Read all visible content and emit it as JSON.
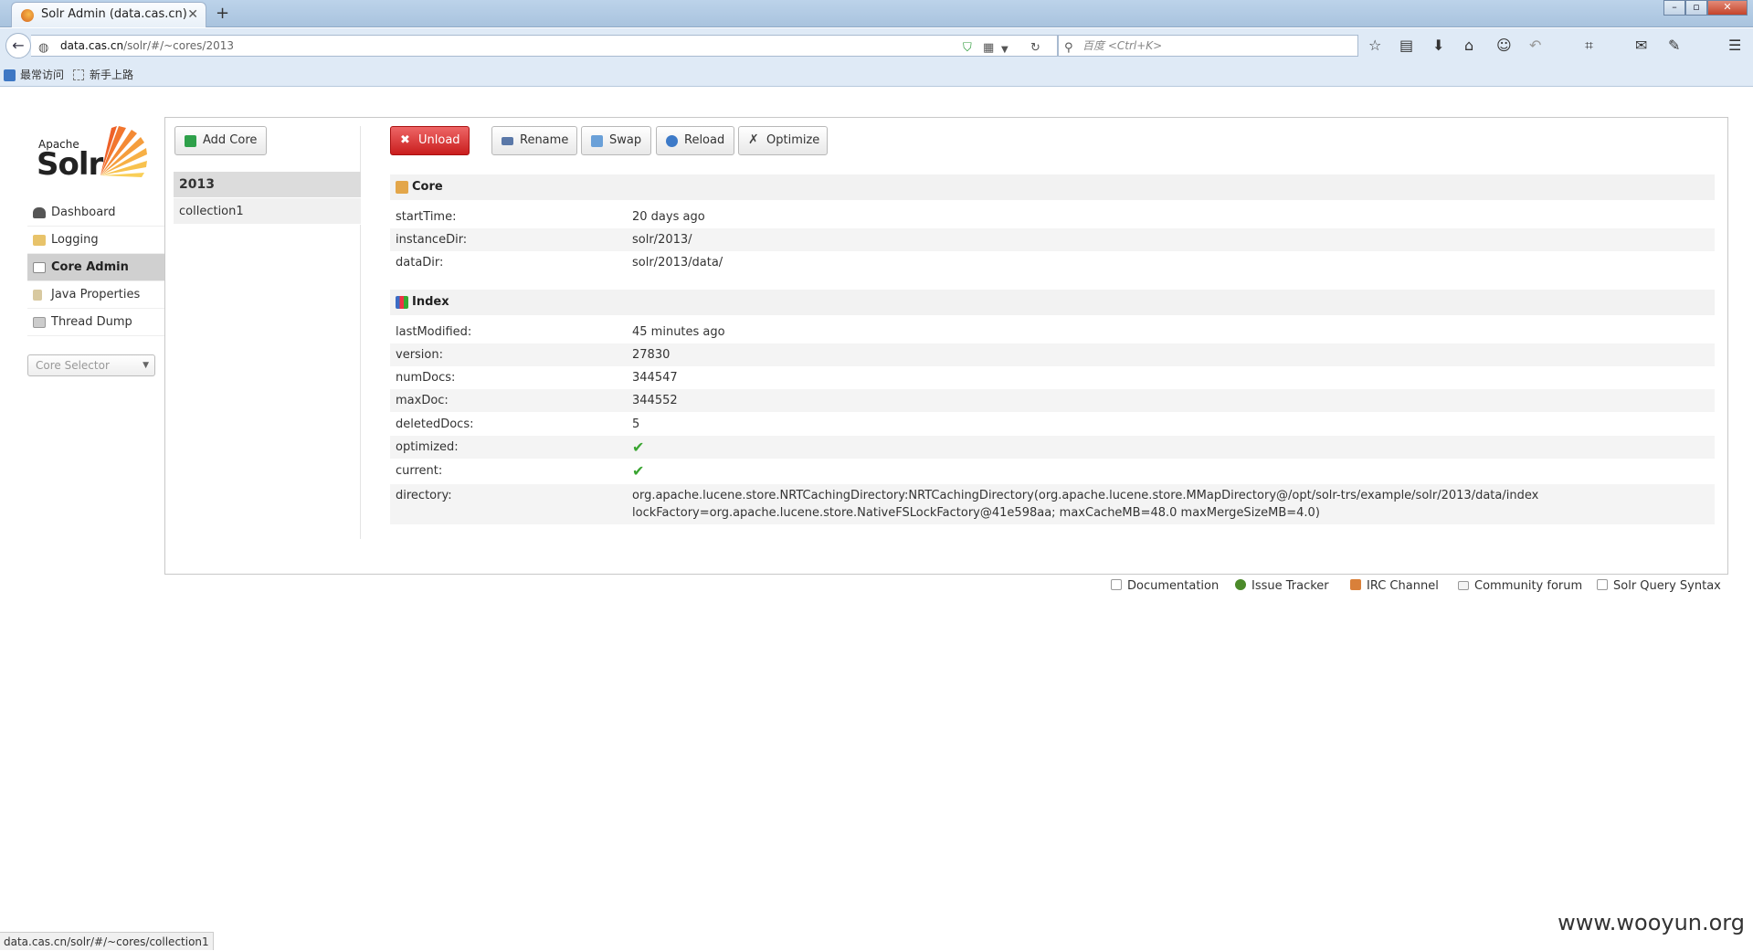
{
  "browser": {
    "tab_title": "Solr Admin (data.cas.cn)",
    "new_tab": "+",
    "tab_close": "✕",
    "url_domain": "data.cas.cn",
    "url_path": "/solr/#/~cores/2013",
    "search_placeholder": "百度 <Ctrl+K>",
    "bookmarks": [
      "最常访问",
      "新手上路"
    ],
    "status_url": "data.cas.cn/solr/#/~cores/collection1"
  },
  "logo": {
    "apache": "Apache",
    "solr": "Solr"
  },
  "sidebar": {
    "items": [
      {
        "label": "Dashboard",
        "icon": "dashboard-icon"
      },
      {
        "label": "Logging",
        "icon": "logging-icon"
      },
      {
        "label": "Core Admin",
        "icon": "core-admin-icon"
      },
      {
        "label": "Java Properties",
        "icon": "java-icon"
      },
      {
        "label": "Thread Dump",
        "icon": "thread-dump-icon"
      }
    ],
    "core_selector": "Core Selector"
  },
  "cores": {
    "add_core": "Add Core",
    "list": [
      "2013",
      "collection1"
    ]
  },
  "toolbar": {
    "unload": "Unload",
    "rename": "Rename",
    "swap": "Swap",
    "reload": "Reload",
    "optimize": "Optimize"
  },
  "core_section": {
    "title": "Core",
    "rows": [
      {
        "key": "startTime:",
        "value": "20 days ago"
      },
      {
        "key": "instanceDir:",
        "value": "solr/2013/"
      },
      {
        "key": "dataDir:",
        "value": "solr/2013/data/"
      }
    ]
  },
  "index_section": {
    "title": "Index",
    "rows": [
      {
        "key": "lastModified:",
        "value": "45 minutes ago"
      },
      {
        "key": "version:",
        "value": "27830"
      },
      {
        "key": "numDocs:",
        "value": "344547"
      },
      {
        "key": "maxDoc:",
        "value": "344552"
      },
      {
        "key": "deletedDocs:",
        "value": "5"
      },
      {
        "key": "optimized:",
        "value": "✔"
      },
      {
        "key": "current:",
        "value": "✔"
      }
    ],
    "directory_key": "directory:",
    "directory_line1": "org.apache.lucene.store.NRTCachingDirectory:NRTCachingDirectory(org.apache.lucene.store.MMapDirectory@/opt/solr-trs/example/solr/2013/data/index",
    "directory_line2": "lockFactory=org.apache.lucene.store.NativeFSLockFactory@41e598aa; maxCacheMB=48.0 maxMergeSizeMB=4.0)"
  },
  "footer": {
    "links": [
      "Documentation",
      "Issue Tracker",
      "IRC Channel",
      "Community forum",
      "Solr Query Syntax"
    ]
  },
  "watermark": "www.wooyun.org"
}
